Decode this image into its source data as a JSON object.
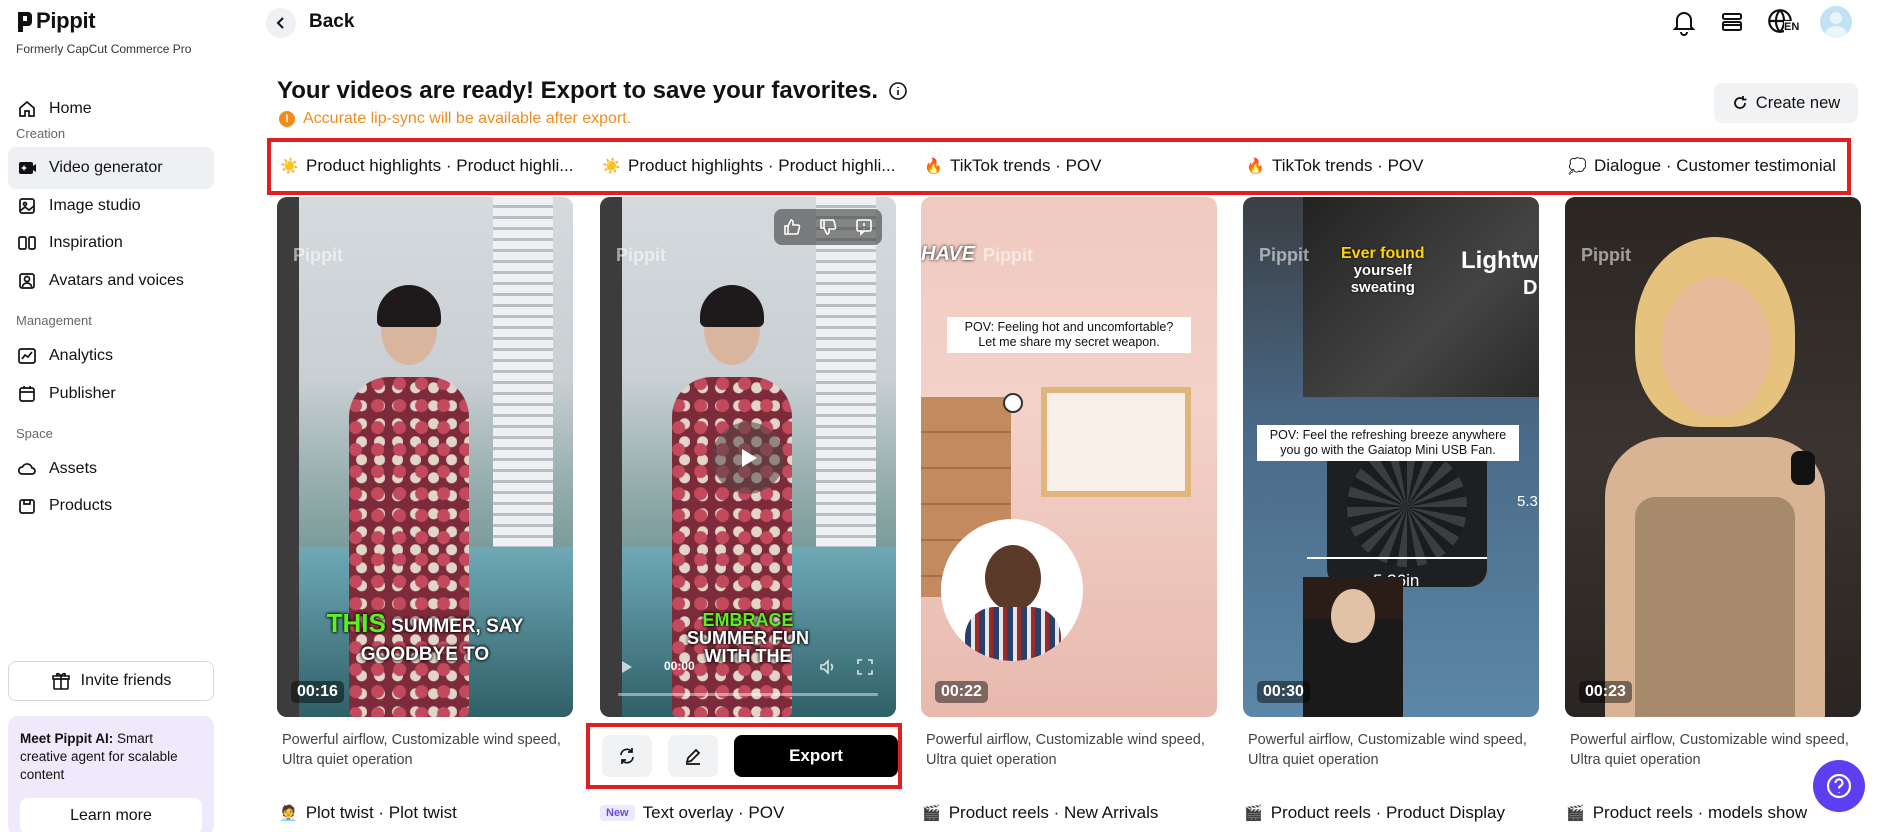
{
  "brand": {
    "name": "Pippit",
    "subtitle": "Formerly CapCut Commerce Pro"
  },
  "sidebar": {
    "home": "Home",
    "sections": {
      "creation": "Creation",
      "management": "Management",
      "space": "Space"
    },
    "items": {
      "video_generator": "Video generator",
      "image_studio": "Image studio",
      "inspiration": "Inspiration",
      "avatars": "Avatars and voices",
      "analytics": "Analytics",
      "publisher": "Publisher",
      "assets": "Assets",
      "products": "Products"
    },
    "invite": "Invite friends",
    "promo": {
      "bold": "Meet Pippit AI:",
      "text": "Smart creative agent for scalable content",
      "button": "Learn more"
    }
  },
  "topbar": {
    "back": "Back",
    "language": "EN"
  },
  "header": {
    "title": "Your videos are ready! Export to save your favorites.",
    "notice": "Accurate lip-sync will be available after export.",
    "create_new": "Create new"
  },
  "categories": [
    {
      "icon": "☀️",
      "label": "Product highlights · Product highli..."
    },
    {
      "icon": "☀️",
      "label": "Product highlights · Product highli..."
    },
    {
      "icon": "🔥",
      "label": "TikTok trends · POV"
    },
    {
      "icon": "🔥",
      "label": "TikTok trends · POV"
    },
    {
      "icon": "💭",
      "label": "Dialogue · Customer testimonial"
    }
  ],
  "cards": [
    {
      "duration": "00:16",
      "desc": "Powerful airflow, Customizable wind speed, Ultra quiet operation",
      "caption_green": "THIS",
      "caption_rest": " SUMMER, SAY GOODBYE TO"
    },
    {
      "time": "00:00",
      "caption_green": "EMBRACE",
      "caption_rest": "SUMMER FUN WITH THE"
    },
    {
      "duration": "00:22",
      "desc": "Powerful airflow, Customizable wind speed, Ultra quiet operation",
      "overlay_top": "HAVE",
      "bubble": "POV: Feeling hot and uncomfortable? Let me share my secret weapon."
    },
    {
      "duration": "00:30",
      "desc": "Powerful airflow, Customizable wind speed, Ultra quiet operation",
      "overlay_a": "Ever found",
      "overlay_b": "yourself sweating",
      "overlay_side": "Lightw",
      "overlay_side2": "D",
      "bubble": "POV: Feel the refreshing breeze anywhere you go with the Gaiatop Mini USB Fan.",
      "dim": "5.36in",
      "dim2": "5.3"
    },
    {
      "duration": "00:23",
      "desc": "Powerful airflow, Customizable wind speed, Ultra quiet operation"
    }
  ],
  "watermark": "Pippit",
  "actions": {
    "export": "Export"
  },
  "bottom_labels": [
    {
      "icon": "🧑‍💼",
      "label": "Plot twist · Plot twist"
    },
    {
      "badge": "New",
      "label": "Text overlay · POV"
    },
    {
      "icon": "🎬",
      "label": "Product reels · New Arrivals"
    },
    {
      "icon": "🎬",
      "label": "Product reels · Product Display"
    },
    {
      "icon": "🎬",
      "label": "Product reels · models show"
    }
  ],
  "colors": {
    "accent_red": "#e02020",
    "notice_orange": "#f08c1e",
    "help_purple": "#5b3ff0"
  }
}
